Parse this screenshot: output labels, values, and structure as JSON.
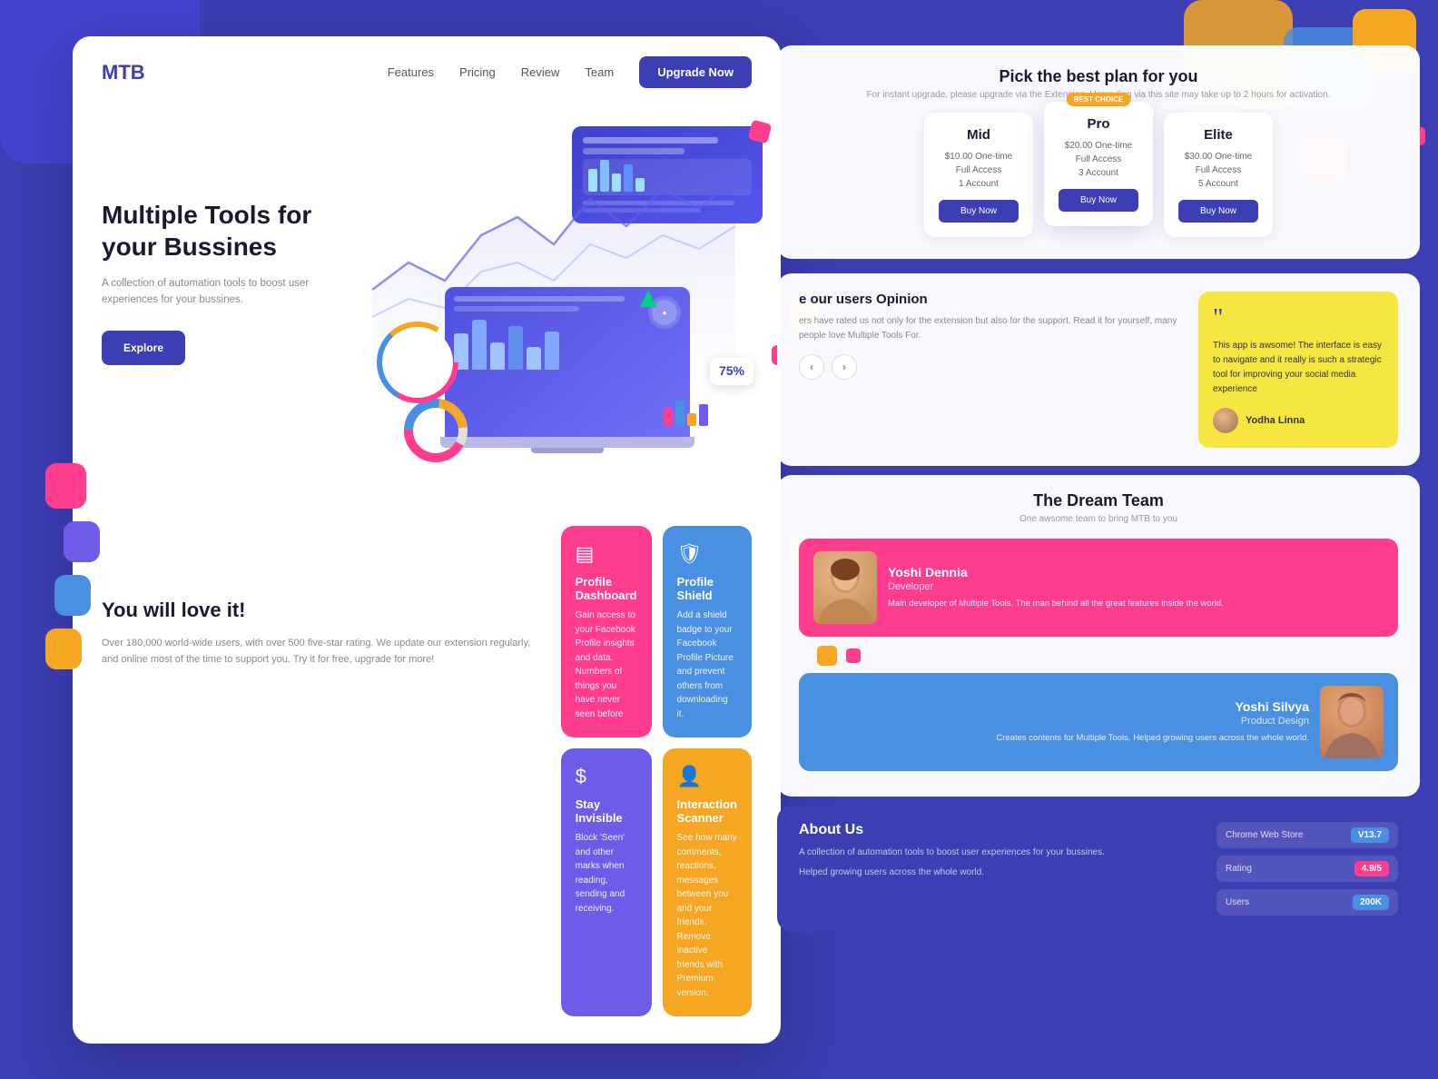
{
  "brand": {
    "logo": "MTB",
    "accent_color": "#3d3db4"
  },
  "nav": {
    "links": [
      "Features",
      "Pricing",
      "Review",
      "Team"
    ],
    "cta_label": "Upgrade Now"
  },
  "hero": {
    "title": "Multiple Tools for your Bussines",
    "description": "A collection of automation tools to boost user experiences for your bussines.",
    "explore_label": "Explore",
    "percent_label": "75%"
  },
  "features_section": {
    "title": "You will love it!",
    "description": "Over 180,000 world-wide users, with over 500 five-star rating. We update our extension regularly, and online most of the time to support you. Try it for free, upgrade for more!",
    "cards": [
      {
        "id": "profile-dashboard",
        "title": "Profile Dashboard",
        "description": "Gain access to your Facebook Profile insights and data. Numbers of things you have never seen before",
        "icon": "▤",
        "color_class": "fc-pink"
      },
      {
        "id": "profile-shield",
        "title": "Profile Shield",
        "description": "Add a shield badge to your Facebook Profile Picture and prevent others from downloading it.",
        "icon": "🛡",
        "color_class": "fc-blue"
      },
      {
        "id": "stay-invisible",
        "title": "Stay Invisible",
        "description": "Block 'Seen' and other marks when reading, sending and receiving.",
        "icon": "$",
        "color_class": "fc-purple"
      },
      {
        "id": "interaction-scanner",
        "title": "Interaction Scanner",
        "description": "See how many comments, reactions, messages between you and your friends. Remove inactive friends with Premium version.",
        "icon": "👤",
        "color_class": "fc-yellow"
      }
    ]
  },
  "pricing": {
    "title": "Pick the best plan for you",
    "subtitle": "For instant upgrade, please upgrade via the Extension. Upgrading via this site may take up to 2 hours for activation.",
    "plans": [
      {
        "name": "Mid",
        "price": "$10.00 One-time",
        "access": "Full Access",
        "accounts": "1 Account",
        "featured": false,
        "badge": null,
        "btn_label": "Buy Now"
      },
      {
        "name": "Pro",
        "price": "$20.00 One-time",
        "access": "Full Access",
        "accounts": "3 Account",
        "featured": true,
        "badge": "BEST CHOICE",
        "btn_label": "Buy Now"
      },
      {
        "name": "Elite",
        "price": "$30.00 One-time",
        "access": "Full Access",
        "accounts": "5 Account",
        "featured": false,
        "badge": null,
        "btn_label": "Buy Now"
      }
    ]
  },
  "testimonial": {
    "section_title": "e our users Opinion",
    "section_desc": "ers have rated us not only for the extension but also for the support. Read it for yourself, many people love Multiple Tools For.",
    "quote": "This app is awsome! The interface is easy to navigate and it really is such a strategic tool for improving your social media experience",
    "author_name": "Yodha Linna",
    "nav_prev": "‹",
    "nav_next": "›"
  },
  "team": {
    "title": "The Dream Team",
    "subtitle": "One awsome team to bring MTB to you",
    "members": [
      {
        "name": "Yoshi Dennia",
        "role": "Developer",
        "description": "Main developer of Multiple Tools. The man behind all the great features inside the world.",
        "color_class": "tc-pink",
        "avatar_color": "#c8a060"
      },
      {
        "name": "Yoshi Silvya",
        "role": "Product Design",
        "description": "Creates contents for Multiple Tools. Helped growing users across the whole world.",
        "color_class": "tc-blue",
        "avatar_color": "#c08060"
      }
    ]
  },
  "about": {
    "title": "About Us",
    "description": "A collection of automation tools to boost user experiences for your bussines.",
    "description2": "Helped growing users across the whole world.",
    "stats": [
      {
        "label": "Chrome Web Store",
        "value": "V13.7",
        "badge_class": "sb-green"
      },
      {
        "label": "Rating",
        "value": "4.9/5",
        "badge_class": "sb-pink"
      },
      {
        "label": "Users",
        "value": "200K",
        "badge_class": "sb-blue"
      }
    ]
  },
  "decorations": {
    "colors": {
      "pink": "#ff3d8f",
      "purple": "#6c5ce7",
      "yellow": "#f5a623",
      "blue": "#4a90e2",
      "dark_blue": "#3d3db4"
    }
  }
}
